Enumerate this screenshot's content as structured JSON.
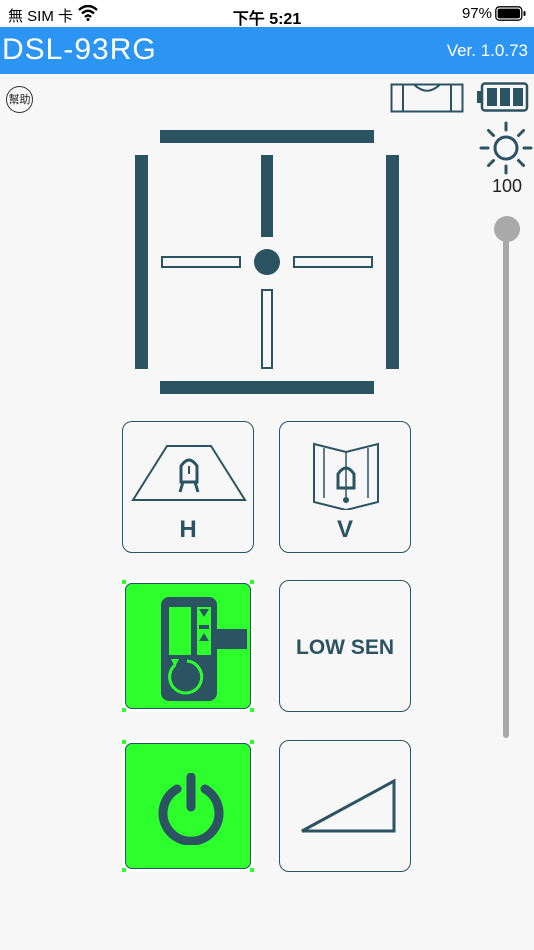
{
  "status_bar": {
    "carrier": "無 SIM 卡",
    "time": "下午 5:21",
    "battery_percent": "97%"
  },
  "header": {
    "title": "DSL-93RG",
    "version": "Ver. 1.0.73"
  },
  "help": {
    "label": "幫助"
  },
  "brightness": {
    "value": "100",
    "level": 1.0
  },
  "buttons": {
    "horizontal": {
      "label": "H"
    },
    "vertical": {
      "label": "V"
    },
    "low_sensitivity": {
      "label": "LOW SEN"
    }
  },
  "colors": {
    "header_bg": "#2c95f3",
    "accent_dark": "#2b5362",
    "active_green": "#2cff2c",
    "slider": "#a9a9a9"
  }
}
